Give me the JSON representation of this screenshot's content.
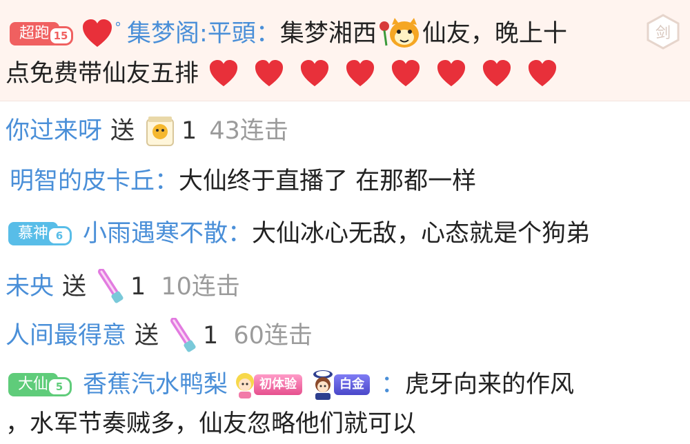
{
  "pinned": {
    "badge_label": "超跑",
    "badge_level": "15",
    "sender": "集梦阁:平頭",
    "msg_part1": "集梦湘西",
    "msg_part2": "仙友，晚上十",
    "msg_line2": "点免费带仙友五排",
    "heart_count": 8,
    "side_icon_label": "剑"
  },
  "rows": [
    {
      "name": "你过来呀",
      "action": "送",
      "count": "1",
      "combo": "43连击"
    },
    {
      "name": "明智的皮卡丘",
      "colon": "：",
      "message": "大仙终于直播了  在那都一样"
    },
    {
      "badge": "慕神",
      "level": "6",
      "name": "小雨遇寒不散",
      "colon": "：",
      "message": "大仙冰心无敌，心态就是个狗弟"
    },
    {
      "name": "未央",
      "action": "送",
      "count": "1",
      "combo": "10连击"
    },
    {
      "name": "人间最得意",
      "action": "送",
      "count": "1",
      "combo": "60连击"
    },
    {
      "badge": "大仙",
      "level": "5",
      "name": "香蕉汽水鸭梨",
      "tag1": "初体验",
      "tag2": "白金",
      "colon": "：",
      "message": "虎牙向来的作风"
    }
  ],
  "last_line": "，水军节奏贼多，仙友忽略他们就可以",
  "colors": {
    "name": "#4a8fd8",
    "badge_red": "#f06060",
    "badge_blue": "#58bde8",
    "badge_green": "#5fcc7a",
    "heart": "#e8303a"
  }
}
